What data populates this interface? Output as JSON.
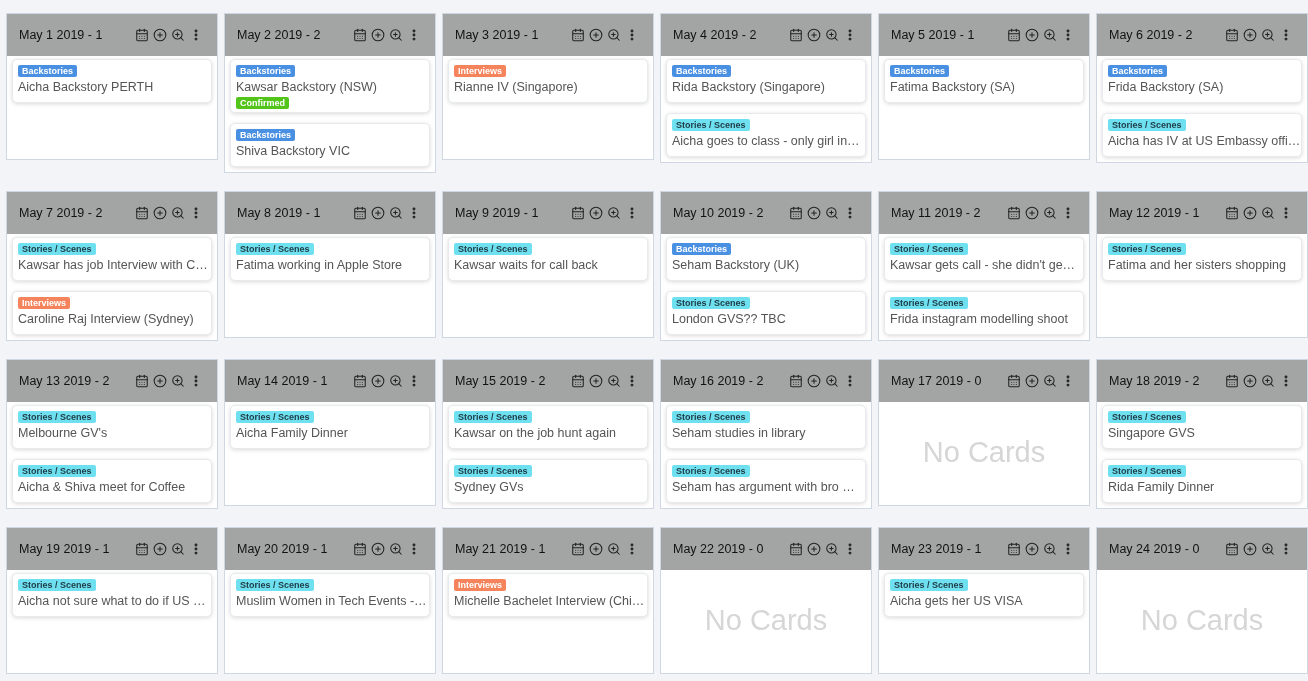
{
  "rows": [
    {
      "columns": [
        {
          "title": "May 1 2019 - 1",
          "cards": [
            {
              "tag": {
                "text": "Backstories",
                "color": "#4a90e2"
              },
              "title": "Aicha Backstory PERTH"
            }
          ]
        },
        {
          "title": "May 2 2019 - 2",
          "cards": [
            {
              "tag": {
                "text": "Backstories",
                "color": "#4a90e2"
              },
              "title": "Kawsar Backstory (NSW)",
              "status": {
                "text": "Confirmed",
                "color": "#52c41a"
              }
            },
            {
              "tag": {
                "text": "Backstories",
                "color": "#4a90e2"
              },
              "title": "Shiva Backstory VIC"
            }
          ]
        },
        {
          "title": "May 3 2019 - 1",
          "cards": [
            {
              "tag": {
                "text": "Interviews",
                "color": "#f5845c"
              },
              "title": "Rianne IV (Singapore)"
            }
          ]
        },
        {
          "title": "May 4 2019 - 2",
          "cards": [
            {
              "tag": {
                "text": "Backstories",
                "color": "#4a90e2"
              },
              "title": "Rida Backstory (Singapore)"
            },
            {
              "tag": {
                "text": "Stories / Scenes",
                "color": "#6ee0f0"
              },
              "title": "Aicha goes to class - only girl in…"
            }
          ]
        },
        {
          "title": "May 5 2019 - 1",
          "cards": [
            {
              "tag": {
                "text": "Backstories",
                "color": "#4a90e2"
              },
              "title": "Fatima Backstory (SA)"
            }
          ]
        },
        {
          "title": "May 6 2019 - 2",
          "cards": [
            {
              "tag": {
                "text": "Backstories",
                "color": "#4a90e2"
              },
              "title": "Frida Backstory (SA)"
            },
            {
              "tag": {
                "text": "Stories / Scenes",
                "color": "#6ee0f0"
              },
              "title": "Aicha has IV at US Embassy offi…"
            }
          ]
        }
      ]
    },
    {
      "columns": [
        {
          "title": "May 7 2019 - 2",
          "cards": [
            {
              "tag": {
                "text": "Stories / Scenes",
                "color": "#6ee0f0"
              },
              "title": "Kawsar has job Interview with C…"
            },
            {
              "tag": {
                "text": "Interviews",
                "color": "#f5845c"
              },
              "title": "Caroline Raj Interview (Sydney)"
            }
          ]
        },
        {
          "title": "May 8 2019 - 1",
          "cards": [
            {
              "tag": {
                "text": "Stories / Scenes",
                "color": "#6ee0f0"
              },
              "title": "Fatima working in Apple Store"
            }
          ]
        },
        {
          "title": "May 9 2019 - 1",
          "cards": [
            {
              "tag": {
                "text": "Stories / Scenes",
                "color": "#6ee0f0"
              },
              "title": "Kawsar waits for call back"
            }
          ]
        },
        {
          "title": "May 10 2019 - 2",
          "cards": [
            {
              "tag": {
                "text": "Backstories",
                "color": "#4a90e2"
              },
              "title": "Seham Backstory (UK)"
            },
            {
              "tag": {
                "text": "Stories / Scenes",
                "color": "#6ee0f0"
              },
              "title": "London GVS?? TBC"
            }
          ]
        },
        {
          "title": "May 11 2019 - 2",
          "cards": [
            {
              "tag": {
                "text": "Stories / Scenes",
                "color": "#6ee0f0"
              },
              "title": "Kawsar gets call - she didn't ge…"
            },
            {
              "tag": {
                "text": "Stories / Scenes",
                "color": "#6ee0f0"
              },
              "title": "Frida instagram modelling shoot"
            }
          ]
        },
        {
          "title": "May 12 2019 - 1",
          "cards": [
            {
              "tag": {
                "text": "Stories / Scenes",
                "color": "#6ee0f0"
              },
              "title": "Fatima and her sisters shopping"
            }
          ]
        }
      ]
    },
    {
      "columns": [
        {
          "title": "May 13 2019 - 2",
          "cards": [
            {
              "tag": {
                "text": "Stories / Scenes",
                "color": "#6ee0f0"
              },
              "title": "Melbourne GV's"
            },
            {
              "tag": {
                "text": "Stories / Scenes",
                "color": "#6ee0f0"
              },
              "title": "Aicha & Shiva meet for Coffee"
            }
          ]
        },
        {
          "title": "May 14 2019 - 1",
          "cards": [
            {
              "tag": {
                "text": "Stories / Scenes",
                "color": "#6ee0f0"
              },
              "title": "Aicha Family Dinner"
            }
          ]
        },
        {
          "title": "May 15 2019 - 2",
          "cards": [
            {
              "tag": {
                "text": "Stories / Scenes",
                "color": "#6ee0f0"
              },
              "title": "Kawsar on the job hunt again"
            },
            {
              "tag": {
                "text": "Stories / Scenes",
                "color": "#6ee0f0"
              },
              "title": "Sydney GVs"
            }
          ]
        },
        {
          "title": "May 16 2019 - 2",
          "cards": [
            {
              "tag": {
                "text": "Stories / Scenes",
                "color": "#6ee0f0"
              },
              "title": "Seham studies in library"
            },
            {
              "tag": {
                "text": "Stories / Scenes",
                "color": "#6ee0f0"
              },
              "title": "Seham has argument with bro …"
            }
          ]
        },
        {
          "title": "May 17 2019 - 0",
          "empty_text": "No Cards"
        },
        {
          "title": "May 18 2019 - 2",
          "cards": [
            {
              "tag": {
                "text": "Stories / Scenes",
                "color": "#6ee0f0"
              },
              "title": "Singapore GVS"
            },
            {
              "tag": {
                "text": "Stories / Scenes",
                "color": "#6ee0f0"
              },
              "title": "Rida Family Dinner"
            }
          ]
        }
      ]
    },
    {
      "columns": [
        {
          "title": "May 19 2019 - 1",
          "cards": [
            {
              "tag": {
                "text": "Stories / Scenes",
                "color": "#6ee0f0"
              },
              "title": "Aicha not sure what to do if US …"
            }
          ]
        },
        {
          "title": "May 20 2019 - 1",
          "cards": [
            {
              "tag": {
                "text": "Stories / Scenes",
                "color": "#6ee0f0"
              },
              "title": "Muslim Women in Tech Events -…"
            }
          ]
        },
        {
          "title": "May 21 2019 - 1",
          "cards": [
            {
              "tag": {
                "text": "Interviews",
                "color": "#f5845c"
              },
              "title": "Michelle Bachelet Interview (Chi…"
            }
          ]
        },
        {
          "title": "May 22 2019 - 0",
          "empty_text": "No Cards"
        },
        {
          "title": "May 23 2019 - 1",
          "cards": [
            {
              "tag": {
                "text": "Stories / Scenes",
                "color": "#6ee0f0"
              },
              "title": "Aicha gets her US VISA"
            }
          ]
        },
        {
          "title": "May 24 2019 - 0",
          "empty_text": "No Cards"
        }
      ]
    }
  ]
}
